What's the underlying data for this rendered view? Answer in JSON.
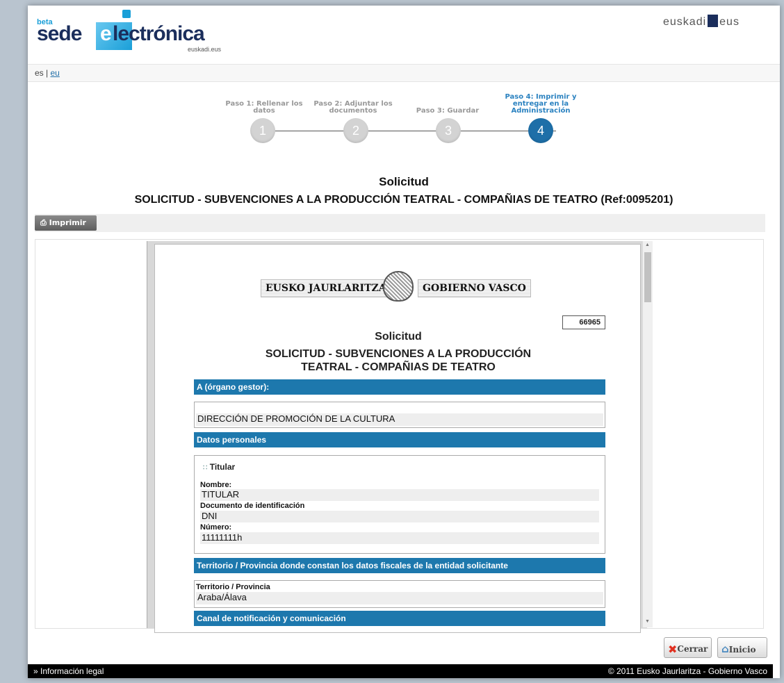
{
  "header": {
    "logo_beta": "beta",
    "logo_sede": "sede",
    "logo_e": "e",
    "logo_electronica": "lectrónica",
    "logo_sub": "euskadi.eus",
    "euskadi_left": "euskadi",
    "euskadi_right": "eus"
  },
  "lang": {
    "es": "es",
    "sep": "|",
    "eu": "eu"
  },
  "steps": [
    {
      "label": "Paso 1: Rellenar los datos",
      "num": "1"
    },
    {
      "label": "Paso 2: Adjuntar los documentos",
      "num": "2"
    },
    {
      "label": "Paso 3: Guardar",
      "num": "3"
    },
    {
      "label": "Paso 4: Imprimir y entregar en la Administración",
      "num": "4"
    }
  ],
  "page": {
    "title": "Solicitud",
    "subtitle": "SOLICITUD - SUBVENCIONES A LA PRODUCCIÓN TEATRAL - COMPAÑIAS DE TEATRO (Ref:0095201)",
    "print_label": "Imprimir"
  },
  "doc": {
    "banner_left": "EUSKO JAURLARITZA",
    "banner_right": "GOBIERNO VASCO",
    "ref": "66965",
    "title": "Solicitud",
    "subtitle_line1": "SOLICITUD - SUBVENCIONES A LA PRODUCCIÓN",
    "subtitle_line2": "TEATRAL - COMPAÑIAS DE TEATRO",
    "sec_organo": "A (órgano gestor):",
    "organo_value": "DIRECCIÓN DE PROMOCIÓN DE LA CULTURA",
    "sec_personales": "Datos personales",
    "titular_heading": "Titular",
    "nombre_label": "Nombre:",
    "nombre_value": "TITULAR",
    "docid_label": "Documento de identificación",
    "docid_value": "DNI",
    "numero_label": "Número:",
    "numero_value": "11111111h",
    "sec_territorio": "Territorio / Provincia donde constan los datos fiscales de la entidad solicitante",
    "territorio_label": "Territorio / Provincia",
    "territorio_value": "Araba/Álava",
    "sec_canal": "Canal de notificación y comunicación"
  },
  "buttons": {
    "cerrar": "Cerrar",
    "inicio": "Inicio"
  },
  "footer": {
    "legal": "» Información legal",
    "copyright": "© 2011 Eusko Jaurlaritza - Gobierno Vasco"
  }
}
